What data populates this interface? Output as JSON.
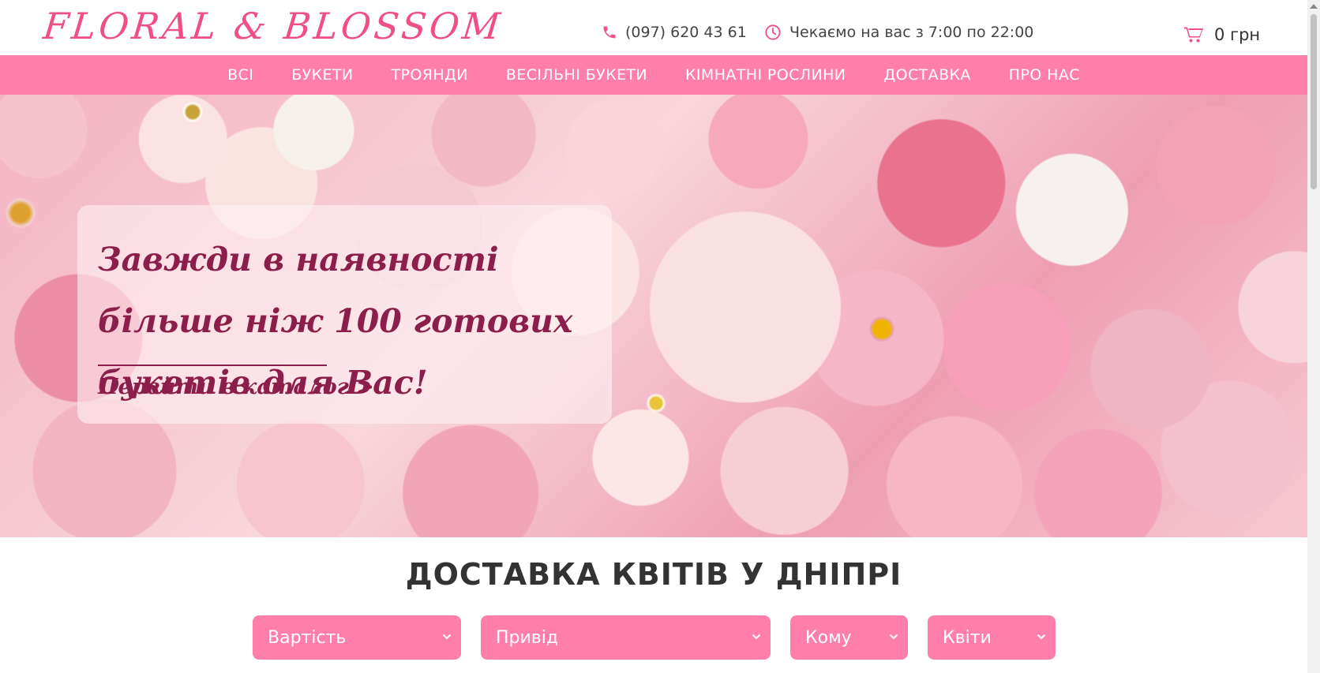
{
  "header": {
    "logo_text": "FLORAL & BLOSSOM",
    "phone_icon": "phone-icon",
    "phone": "(097) 620 43 61",
    "clock_icon": "clock-icon",
    "hours": "Чекаємо на вас з 7:00 по 22:00",
    "cart_icon": "cart-icon",
    "cart_total": "0 грн"
  },
  "nav": {
    "items": [
      {
        "label": "ВСІ"
      },
      {
        "label": "БУКЕТИ"
      },
      {
        "label": "ТРОЯНДИ"
      },
      {
        "label": "ВЕСІЛЬНІ БУКЕТИ"
      },
      {
        "label": "КІМНАТНІ РОСЛИНИ"
      },
      {
        "label": "ДОСТАВКА"
      },
      {
        "label": "ПРО НАС"
      }
    ]
  },
  "hero": {
    "title": "Завжди в наявності більше ніж 100 готових букетів для Вас!",
    "link": "Перейти в каталог >"
  },
  "section": {
    "title": "ДОСТАВКА КВІТІВ У ДНІПРІ"
  },
  "filters": [
    {
      "label": "Вартість"
    },
    {
      "label": "Привід"
    },
    {
      "label": "Кому"
    },
    {
      "label": "Квіти"
    }
  ],
  "colors": {
    "accent": "#ff7eaa",
    "logo": "#f04f86",
    "hero_text": "#8c1e4b"
  }
}
